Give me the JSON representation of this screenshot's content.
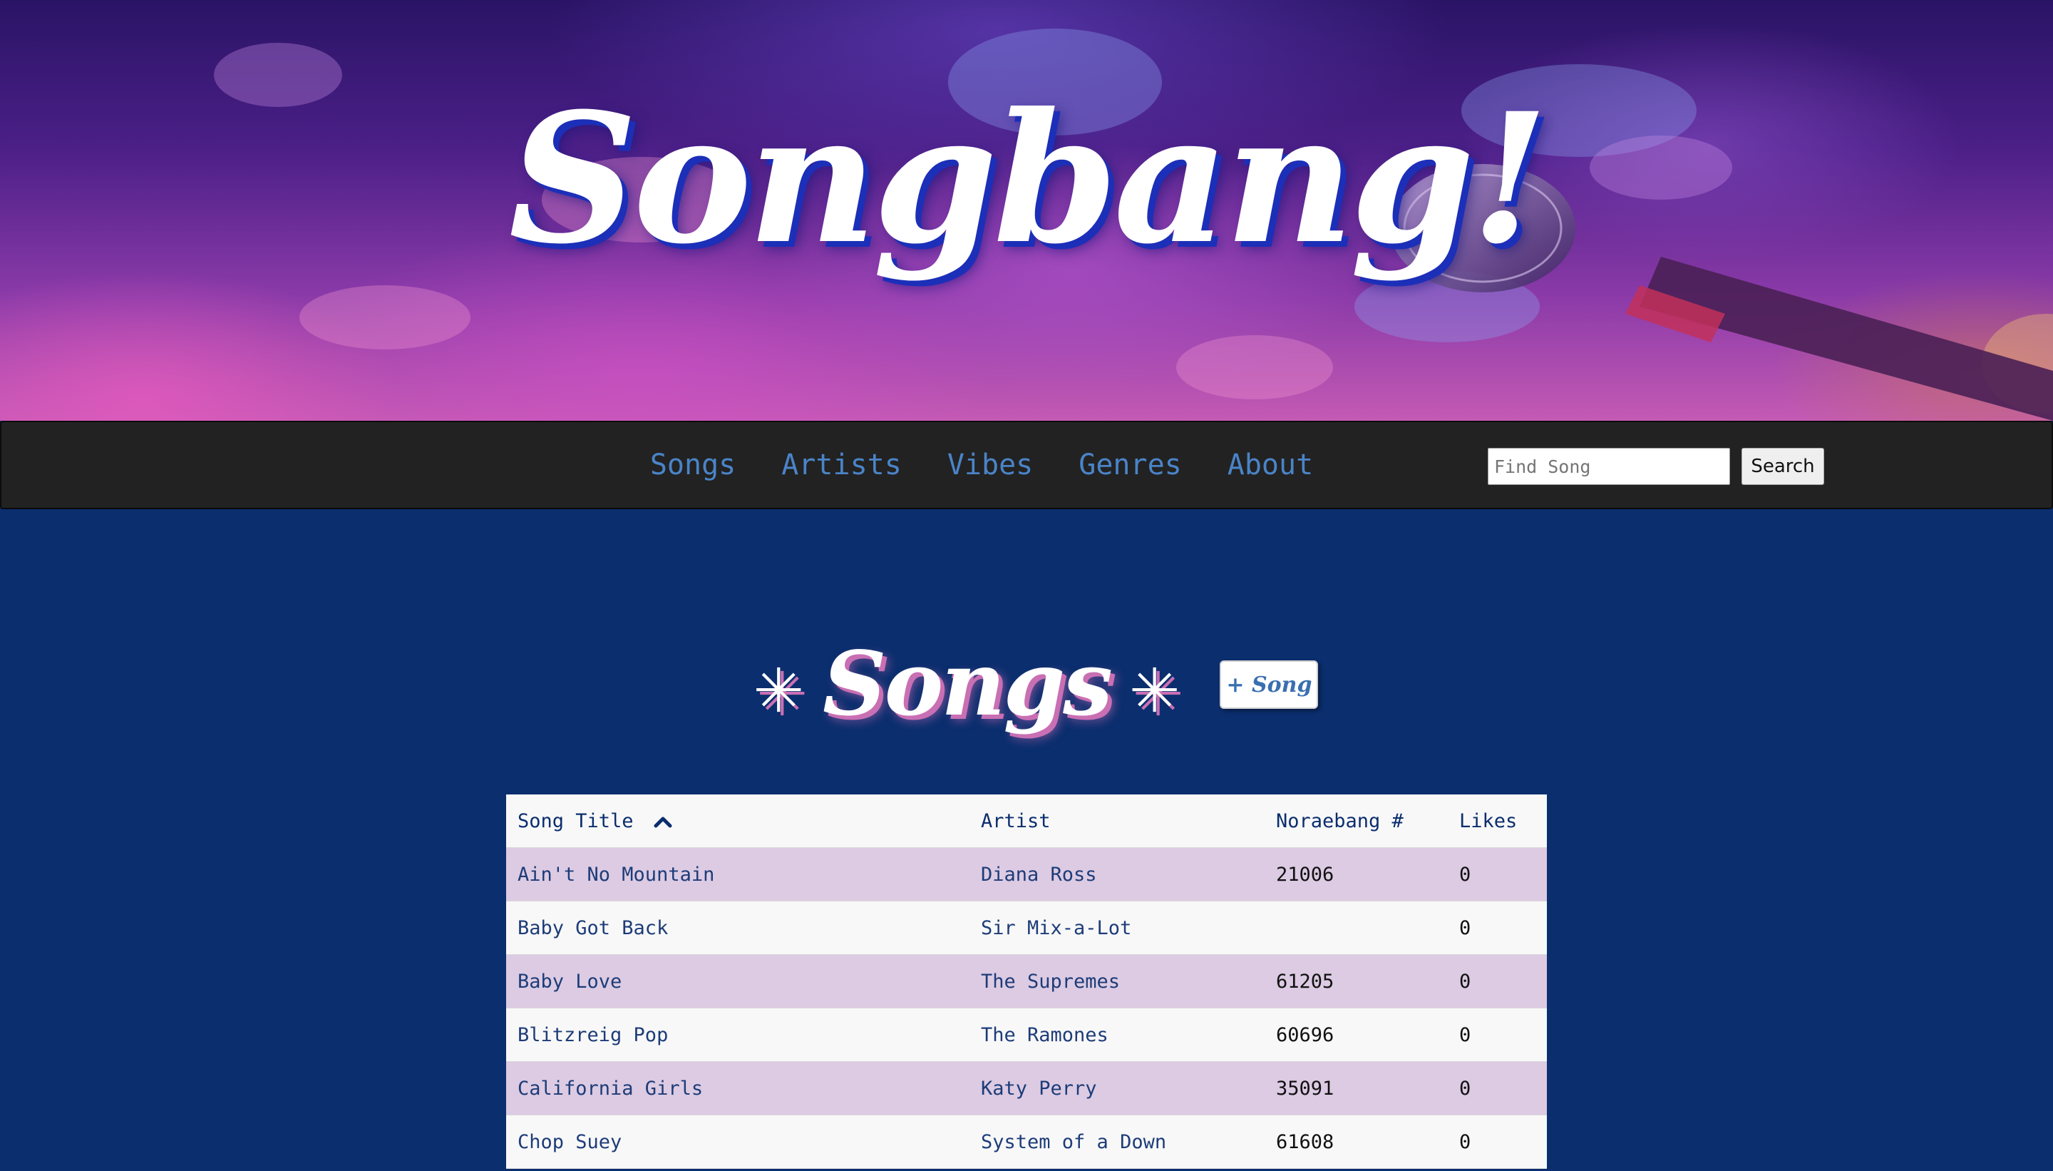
{
  "hero": {
    "title": "Songbang!"
  },
  "navbar": {
    "links": [
      {
        "label": "Songs"
      },
      {
        "label": "Artists"
      },
      {
        "label": "Vibes"
      },
      {
        "label": "Genres"
      },
      {
        "label": "About"
      }
    ],
    "search": {
      "placeholder": "Find Song",
      "value": "",
      "button_label": "Search"
    }
  },
  "page": {
    "heading": "Songs",
    "sparkle_glyph": "✳",
    "add_button_label": "+ Song"
  },
  "table": {
    "columns": [
      "Song Title",
      "Artist",
      "Noraebang #",
      "Likes"
    ],
    "sort": {
      "column": "Song Title",
      "direction": "ascending",
      "icon": "chevron-up-icon"
    },
    "rows": [
      {
        "title": "Ain't No Mountain",
        "artist": "Diana Ross",
        "number": "21006",
        "likes": "0"
      },
      {
        "title": "Baby Got Back",
        "artist": "Sir Mix-a-Lot",
        "number": "",
        "likes": "0"
      },
      {
        "title": "Baby Love",
        "artist": "The Supremes",
        "number": "61205",
        "likes": "0"
      },
      {
        "title": "Blitzreig Pop",
        "artist": "The Ramones",
        "number": "60696",
        "likes": "0"
      },
      {
        "title": "California Girls",
        "artist": "Katy Perry",
        "number": "35091",
        "likes": "0"
      },
      {
        "title": "Chop Suey",
        "artist": "System of a Down",
        "number": "61608",
        "likes": "0"
      }
    ]
  },
  "colors": {
    "page_background": "#0b2e6e",
    "navbar_background": "#222222",
    "nav_link": "#4a84c8",
    "row_highlight": "#dccbe3",
    "row_plain": "#f8f8f8",
    "title_shadow": "#1c2fb8",
    "heading_shadow": "#c96fb3"
  }
}
